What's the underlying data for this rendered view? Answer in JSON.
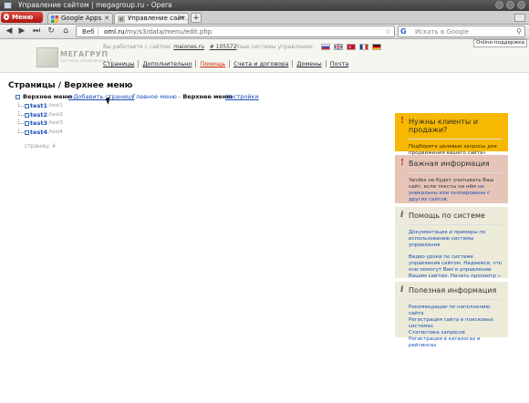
{
  "window": {
    "title": "Управление сайтом | megagroup.ru - Opera"
  },
  "browser": {
    "menu_label": "Меню",
    "tabs": [
      {
        "label": "Google Apps",
        "active": false
      },
      {
        "label": "Управление сайт...",
        "active": true
      }
    ],
    "new_tab": "+",
    "address_prefix": "Веб",
    "url_host": "oml.ru",
    "url_path": "/my/s3/data/menu/edit.php",
    "search_placeholder": "Искать в Google",
    "search_engine": "G"
  },
  "site_header": {
    "logo_name": "МЕГАГРУП",
    "logo_sub": "система управления 3.0",
    "working_with_label": "Вы работаете с сайтом:",
    "site_name": "maiones.ru",
    "site_id": "# 105572",
    "lang_label": "Язык системы управления:",
    "online_help": "Online-поддержка",
    "nav": [
      "Страницы",
      "Дополнительно",
      "Помощь",
      "Счета и договора",
      "Домены",
      "Почта"
    ]
  },
  "main": {
    "page_title": "Страницы / Верхнее меню",
    "root_label": "Верхнее меню",
    "add_page": "+Добавить страницу",
    "breadcrumb_prefix": "Главное меню -",
    "breadcrumb_current": "Верхнее меню",
    "settings_link": "Настройки",
    "items": [
      {
        "name": "test1",
        "path": "/test1"
      },
      {
        "name": "test2",
        "path": "/test2"
      },
      {
        "name": "test3",
        "path": "/test3"
      },
      {
        "name": "test4",
        "path": "/test4"
      }
    ],
    "pages_count": "страниц: 4"
  },
  "sidebar": {
    "clients": {
      "title": "Нужны клиенты и продажи?",
      "text": "Подберите целевые запросы для продвижения вашего сайта»"
    },
    "important": {
      "title": "Важная информация",
      "text_a": "Yandex не будет учитывать Ваш сайт, если тексты на нём ",
      "text_link": "не уникальны или скопированы с других сайтов",
      "text_b": "."
    },
    "help": {
      "title": "Помощь по системе",
      "link1": "Документация и примеры по использованию системы управления",
      "link2": "Видео уроки по системе управления сайтом. Надеемся, что они помогут Вам в управлении Вашим сайтом.",
      "link2_more": "Начать просмотр »"
    },
    "useful": {
      "title": "Полезная информация",
      "links": [
        "Рекомендации по наполнению сайта",
        "Регистрация сайта в поисковых системах",
        "Статистика запросов",
        "Регистрация в каталогах и рейтингах"
      ]
    }
  }
}
